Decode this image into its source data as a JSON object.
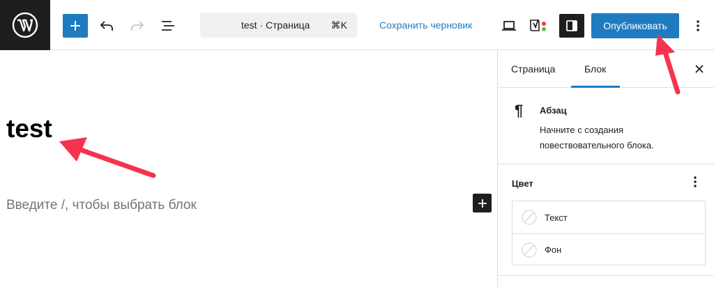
{
  "topbar": {
    "logo_icon": "wordpress-logo-icon",
    "add_icon": "plus-icon",
    "undo_icon": "undo-icon",
    "redo_icon": "redo-icon",
    "document_overview_icon": "list-view-icon",
    "command": {
      "title": "test · Страница",
      "shortcut": "⌘K"
    },
    "save_draft": "Сохранить черновик",
    "preview_icon": "laptop-icon",
    "seo_icon": "yoast-icon",
    "settings_toggle_icon": "sidebar-toggle-icon",
    "publish": "Опубликовать",
    "options_icon": "more-vertical-icon"
  },
  "editor": {
    "post_title": "test",
    "block_placeholder": "Введите /, чтобы выбрать блок",
    "inline_add_icon": "plus-icon"
  },
  "sidebar": {
    "tabs": [
      {
        "label": "Страница",
        "active": false
      },
      {
        "label": "Блок",
        "active": true
      }
    ],
    "close_icon": "close-icon",
    "block": {
      "icon": "paragraph-icon",
      "name": "Абзац",
      "description": "Начните с создания повествовательного блока."
    },
    "color": {
      "title": "Цвет",
      "options_icon": "more-vertical-icon",
      "items": [
        {
          "label": "Текст",
          "swatch": "no-color-icon"
        },
        {
          "label": "Фон",
          "swatch": "no-color-icon"
        }
      ]
    }
  },
  "annotations": {
    "arrow_color": "#f5334d",
    "arrows": [
      "arrow-to-post-title",
      "arrow-to-publish-button"
    ]
  },
  "colors": {
    "accent": "#1e7bc0",
    "dark": "#1e1e1e",
    "border": "#e0e0e0",
    "placeholder": "#757575",
    "annotation_red": "#f5334d"
  }
}
